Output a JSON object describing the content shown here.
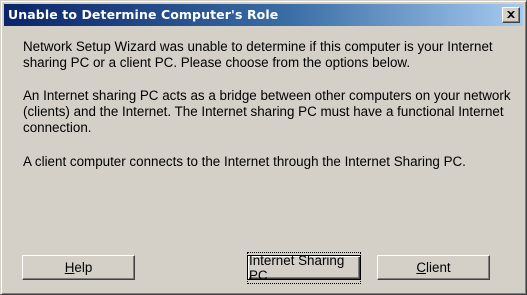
{
  "window": {
    "title": "Unable to Determine Computer's Role"
  },
  "message": {
    "paragraph1": "Network Setup Wizard was unable to determine if this computer is your Internet sharing PC or a client PC.  Please choose from the options below.",
    "paragraph2": "An Internet sharing PC acts as a bridge between other computers on your network (clients) and the Internet.  The Internet sharing PC must have a functional Internet connection.",
    "paragraph3": "A client computer connects to the Internet through the Internet Sharing PC."
  },
  "buttons": {
    "help": {
      "accel": "H",
      "rest": "elp"
    },
    "internet_sharing_pc": {
      "label": "Internet Sharing PC"
    },
    "client": {
      "accel": "C",
      "rest": "lient"
    }
  },
  "icons": {
    "close": "close-icon"
  }
}
